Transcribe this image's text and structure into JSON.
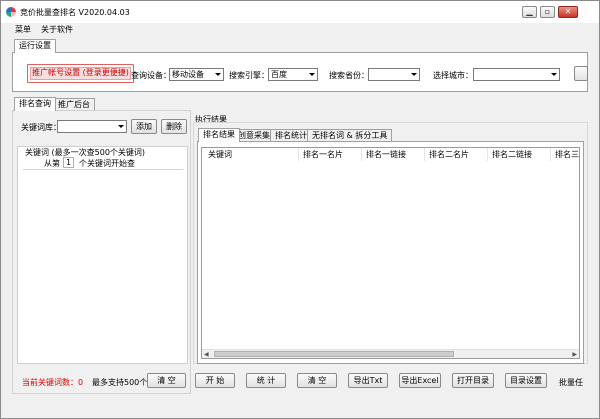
{
  "window": {
    "title": "竞价批量查排名 V2020.04.03"
  },
  "titlebar": {
    "minimize": "▁",
    "maximize": "▫",
    "close": "✕"
  },
  "menu": [
    "菜单",
    "关于软件"
  ],
  "settings": {
    "tab": "运行设置",
    "promo_button": "推广帐号设置 (登录更便捷)",
    "device_label": "查询设备：",
    "device_value": "移动设备",
    "engine_label": "搜索引擎：",
    "engine_value": "百度",
    "province_label": "搜索省份：",
    "province_value": "",
    "city_label": "选择城市：",
    "city_value": ""
  },
  "left_tabs": [
    "排名查询",
    "推广后台"
  ],
  "left": {
    "keyword_lib_label": "关键词库：",
    "keyword_lib_value": "",
    "add_button": "添加",
    "delete_button": "删除",
    "keywords_caption": "关键词 (最多一次查500个关键词)",
    "from_label": "从第",
    "start_value": "1",
    "start_suffix": "个关键词开始查",
    "count_label": "当前关键词数：",
    "count_value": "0",
    "max_label": "最多支持500个",
    "clear_button": "清 空"
  },
  "results": {
    "caption": "执行结果",
    "tabs": [
      "排名结果",
      "创意采集",
      "排名统计",
      "无排名词 & 拆分工具"
    ],
    "columns": [
      "关键词",
      "排名一名片",
      "排名一链接",
      "排名二名片",
      "排名二链接",
      "排名三名"
    ],
    "rows": []
  },
  "actions": {
    "start": "开 始",
    "stats": "统 计",
    "clear": "清 空",
    "export_txt": "导出Txt",
    "export_excel": "导出Excel",
    "open_dir": "打开目录",
    "dir_settings": "目录设置",
    "batch_partial": "批量任"
  },
  "colors": {
    "red": "#e00000",
    "window_bg": "#f0f0f0"
  }
}
